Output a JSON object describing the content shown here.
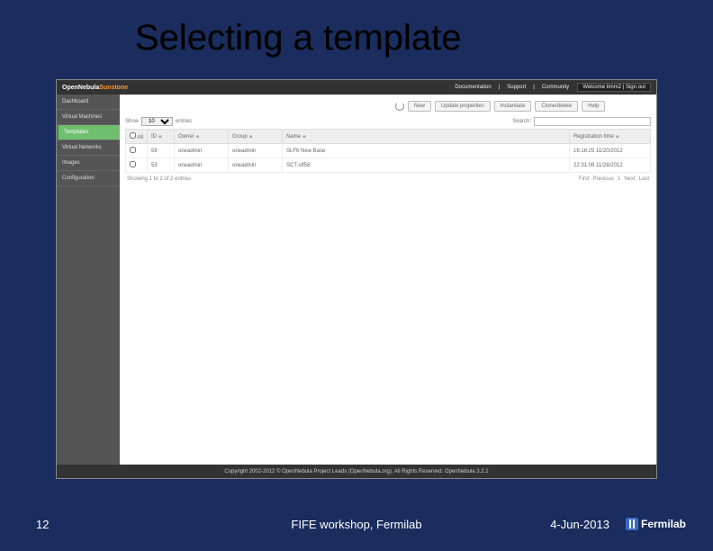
{
  "slide": {
    "title": "Selecting a template",
    "number": "12",
    "footer_center": "FIFE workshop, Fermilab",
    "date": "4-Jun-2013",
    "logo_text": "Fermilab"
  },
  "app": {
    "brand_main": "OpenNebula",
    "brand_sub": "Sunstone",
    "topbar_links": {
      "documentation": "Documentation",
      "support": "Support",
      "community": "Community"
    },
    "welcome": "Welcome timm2 | Sign out",
    "sidebar": {
      "items": [
        {
          "label": "Dashboard"
        },
        {
          "label": "Virtual Machines"
        },
        {
          "label": "Templates"
        },
        {
          "label": "Virtual Networks"
        },
        {
          "label": "Images"
        },
        {
          "label": "Configuration"
        }
      ]
    },
    "toolbar": {
      "new": "New",
      "update": "Update properties",
      "instantiate": "Instantiate",
      "clonedelete": "Clone/delete",
      "help": "Help"
    },
    "show": {
      "prefix": "Show",
      "value": "10",
      "suffix": "entries",
      "search_label": "Search:"
    },
    "table": {
      "headers": {
        "all": "All",
        "id": "ID",
        "owner": "Owner",
        "group": "Group",
        "name": "Name",
        "regtime": "Registration time"
      },
      "rows": [
        {
          "id": "58",
          "owner": "oneadmin",
          "group": "oneadmin",
          "name": "SLF6 New Base",
          "regtime": "16:16:25 11/20/2012"
        },
        {
          "id": "53",
          "owner": "oneadmin",
          "group": "oneadmin",
          "name": "SCT-slf58",
          "regtime": "22:31:08 11/28/2012"
        }
      ],
      "footer_info": "Showing 1 to 2 of 2 entries",
      "pagination": {
        "first": "First",
        "prev": "Previous",
        "page": "1",
        "next": "Next",
        "last": "Last"
      }
    },
    "footer": "Copyright 2002-2012 © OpenNebula Project Leads (OpenNebula.org). All Rights Reserved. OpenNebula 3.2.1"
  }
}
